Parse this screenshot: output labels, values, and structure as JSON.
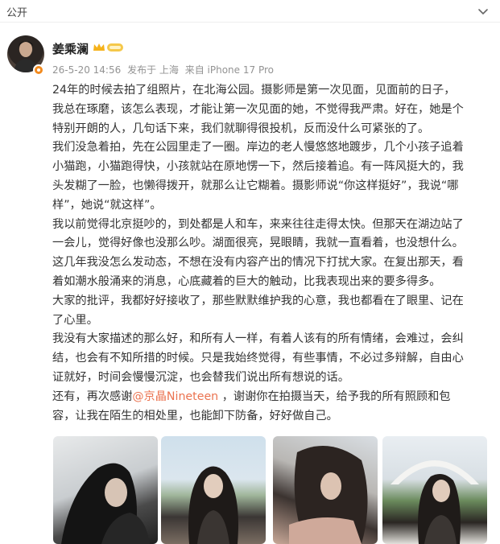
{
  "header": {
    "visibility": "公开",
    "menu_icon": "chevron-down-icon"
  },
  "post": {
    "author": "姜乘澜",
    "badge_icon": "vip-crown-icon",
    "date": "26-5-20 14:56",
    "published_in": "发布于 上海",
    "source": "来自 iPhone 17 Pro",
    "paragraph_lines": [
      [
        "24年的时候去拍了组照片，在北海公园。摄影师是第一次见面，见面前的日子，",
        "我总在琢磨，该怎么表现，才能让第一次见面的她，不觉得我严肃。好在，她是个",
        "特别开朗的人，几句话下来，我们就聊得很投机，反而没什么可紧张的了。"
      ],
      [
        "我们没急着拍，先在公园里走了一圈。岸边的老人慢悠悠地踱步，几个小孩子追着",
        "小猫跑，小猫跑得快，小孩就站在原地愣一下，然后接着追。有一阵风挺大的，我",
        "头发糊了一脸，也懒得拨开，就那么让它糊着。摄影师说“你这样挺好”，我说“哪",
        "样”，她说“就这样”。"
      ],
      [
        "我以前觉得北京挺吵的，到处都是人和车，来来往往走得太快。但那天在湖边站了",
        "一会儿，觉得好像也没那么吵。湖面很亮，晃眼睛，我就一直看着，也没想什么。"
      ],
      [
        "这几年我没怎么发动态，不想在没有内容产出的情况下打扰大家。在复出那天，看",
        "着如潮水般涌来的消息，心底藏着的巨大的触动，比我表现出来的要多得多。"
      ],
      [
        "大家的批评，我都好好接收了，那些默默维护我的心意，我也都看在了眼里、记在",
        "了心里。"
      ],
      [
        "我没有大家描述的那么好，和所有人一样，有着人该有的所有情绪，会难过，会纠",
        "结，也会有不知所措的时候。只是我始终觉得，有些事情，不必过多辩解，自由心",
        "证就好，时间会慢慢沉淀，也会替我们说出所有想说的话。"
      ]
    ],
    "closing": {
      "lead": "还有，再次感谢",
      "mention": "@京晶Nineteen",
      "rest_line1": " ，谢谢你在拍摄当天，给予我的所有照顾和包",
      "line2": "容，让我在陌生的相处里，也能卸下防备，好好做自己。"
    },
    "photos": [
      "photo-1",
      "photo-2",
      "photo-3",
      "photo-4"
    ],
    "colors": {
      "mention": "#eb7350",
      "meta": "#939393",
      "text": "#333333"
    }
  }
}
